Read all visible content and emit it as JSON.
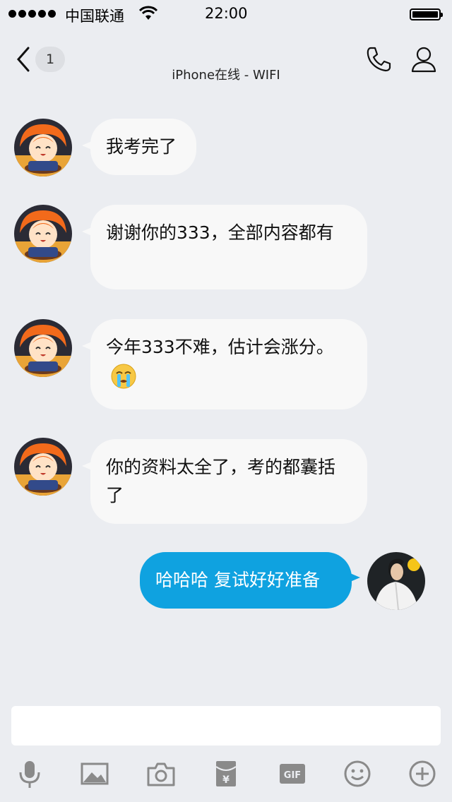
{
  "status_bar": {
    "carrier": "中国联通",
    "time": "22:00"
  },
  "nav": {
    "back_badge": "1",
    "subtitle": "iPhone在线 - WIFI"
  },
  "messages": [
    {
      "direction": "in",
      "text": "我考完了"
    },
    {
      "direction": "in",
      "text": "谢谢你的333，全部内容都有"
    },
    {
      "direction": "in",
      "text": "今年333不难，估计会涨分。",
      "emoji": "crying-face-icon"
    },
    {
      "direction": "in",
      "text": "你的资料太全了，考的都囊括了"
    },
    {
      "direction": "out",
      "text": "哈哈哈 复试好好准备"
    }
  ],
  "input": {
    "value": "",
    "placeholder": ""
  },
  "toolbar": [
    "microphone-icon",
    "image-icon",
    "camera-icon",
    "red-packet-icon",
    "gif-icon",
    "emoji-icon",
    "plus-icon"
  ],
  "colors": {
    "background": "#ebedf1",
    "incoming_bubble": "#f8f8f8",
    "outgoing_bubble": "#0fa2e0"
  }
}
